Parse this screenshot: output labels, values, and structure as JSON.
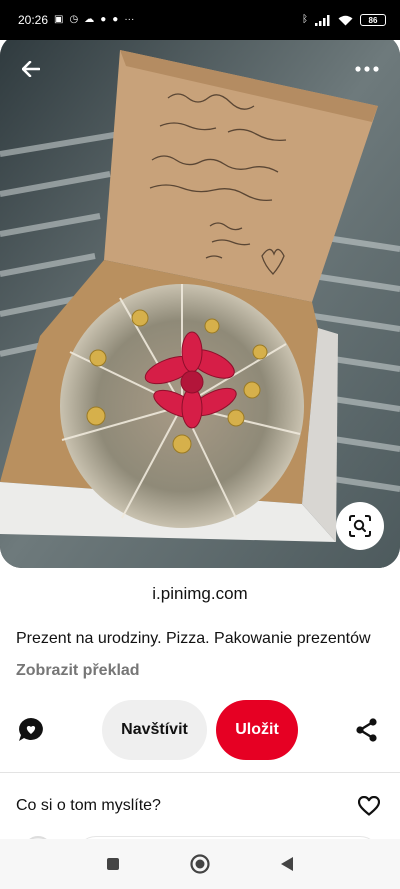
{
  "status_bar": {
    "time": "20:26",
    "battery": "86",
    "icons": [
      "image-icon",
      "alarm-icon",
      "weather-icon",
      "app-icon",
      "app-icon",
      "more-notifications-icon",
      "bluetooth-icon",
      "signal-icon",
      "wifi-icon",
      "battery-icon"
    ]
  },
  "hero": {
    "image_subject": "pizza box with money and red bow",
    "icons": {
      "back": "back-arrow-icon",
      "more": "more-dots-icon",
      "lens": "visual-search-icon"
    }
  },
  "pin": {
    "source": "i.pinimg.com",
    "title": "Prezent na urodziny. Pizza. Pakowanie prezentów",
    "translate_label": "Zobrazit překlad"
  },
  "actions": {
    "visit_label": "Navštívit",
    "save_label": "Uložit",
    "save_color": "#e60023",
    "visit_color": "#efefef"
  },
  "comments": {
    "prompt": "Co si o tom myslíte?"
  },
  "nav": {
    "icons": [
      "recents-square-icon",
      "home-circle-icon",
      "back-triangle-icon"
    ]
  }
}
